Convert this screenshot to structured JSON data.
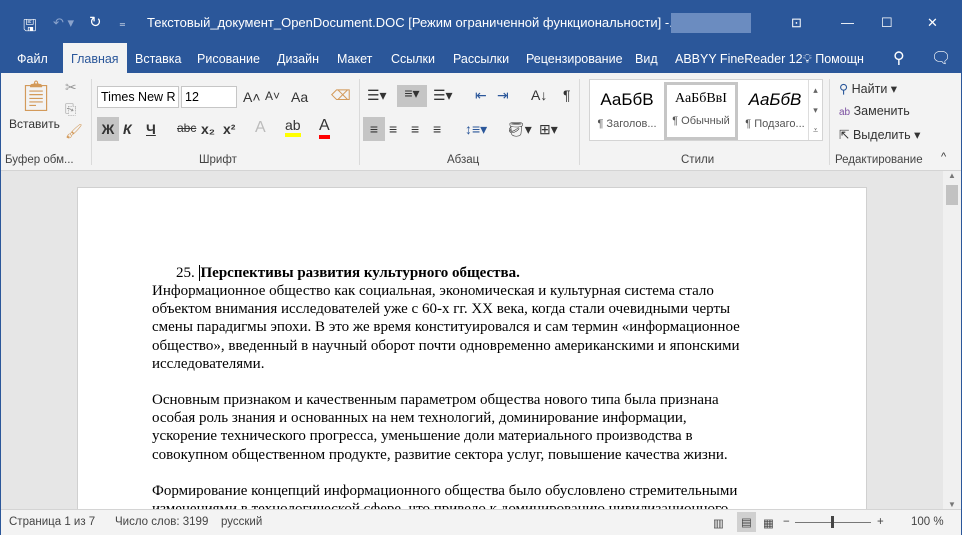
{
  "titlebar": {
    "title": "Текстовый_документ_OpenDocument.DOC [Режим ограниченной функциональности]  -...",
    "icons": [
      "save-icon",
      "undo-icon",
      "redo-icon",
      "customize-icon",
      "ribbon-display-icon",
      "minimize-icon",
      "maximize-icon",
      "close-icon"
    ]
  },
  "tabs": [
    "Файл",
    "Главная",
    "Вставка",
    "Рисование",
    "Дизайн",
    "Макет",
    "Ссылки",
    "Рассылки",
    "Рецензирование",
    "Вид",
    "ABBYY FineReader 12"
  ],
  "help": "Помощн",
  "ribbon": {
    "clipboard": {
      "paste": "Вставить",
      "group": "Буфер обм..."
    },
    "font": {
      "name": "Times New R",
      "size": "12",
      "group": "Шрифт",
      "bold": "Ж",
      "italic": "К",
      "underline": "Ч",
      "strike": "abc",
      "sub": "x₂",
      "sup": "x²",
      "change_case": "Aa",
      "highlight_color": "#ffff00",
      "font_color": "#ff0000"
    },
    "paragraph": {
      "group": "Абзац"
    },
    "styles": {
      "group": "Стили",
      "items": [
        {
          "sample": "АаБбВ",
          "label": "¶ Заголов..."
        },
        {
          "sample": "АаБбВвI",
          "label": "¶ Обычный"
        },
        {
          "sample": "АаБбВ",
          "label": "¶ Подзаго..."
        }
      ]
    },
    "editing": {
      "group": "Редактирование",
      "find": "Найти",
      "replace": "Заменить",
      "select": "Выделить"
    }
  },
  "document": {
    "heading_num": "25.",
    "heading": "Перспективы развития культурного общества.",
    "paragraphs": [
      [
        "Информационное общество как социальная, экономическая и культурная система стало",
        "объектом внимания исследователей уже с 60-х гг. XX века, когда стали очевидными черты",
        "смены парадигмы эпохи. В это же время конституировался и сам термин «информационное",
        "общество», введенный в научный оборот почти одновременно американскими и японскими",
        "исследователями."
      ],
      [
        "Основным признаком и качественным параметром общества нового типа была признана",
        "особая роль знания и основанных на нем технологий, доминирование информации,",
        "ускорение технического прогресса, уменьшение доли материального производства в",
        "совокупном общественном продукте, развитие сектора услуг, повышение качества жизни."
      ],
      [
        "Формирование концепций информационного общества было обусловлено стремительными",
        "изменениями в технологической сфере, что привело к доминированию цивилизационного"
      ]
    ]
  },
  "status": {
    "page": "Страница 1 из 7",
    "words": "Число слов: 3199",
    "lang": "русский",
    "zoom": "100 %",
    "zoom_level_percent": 100
  }
}
